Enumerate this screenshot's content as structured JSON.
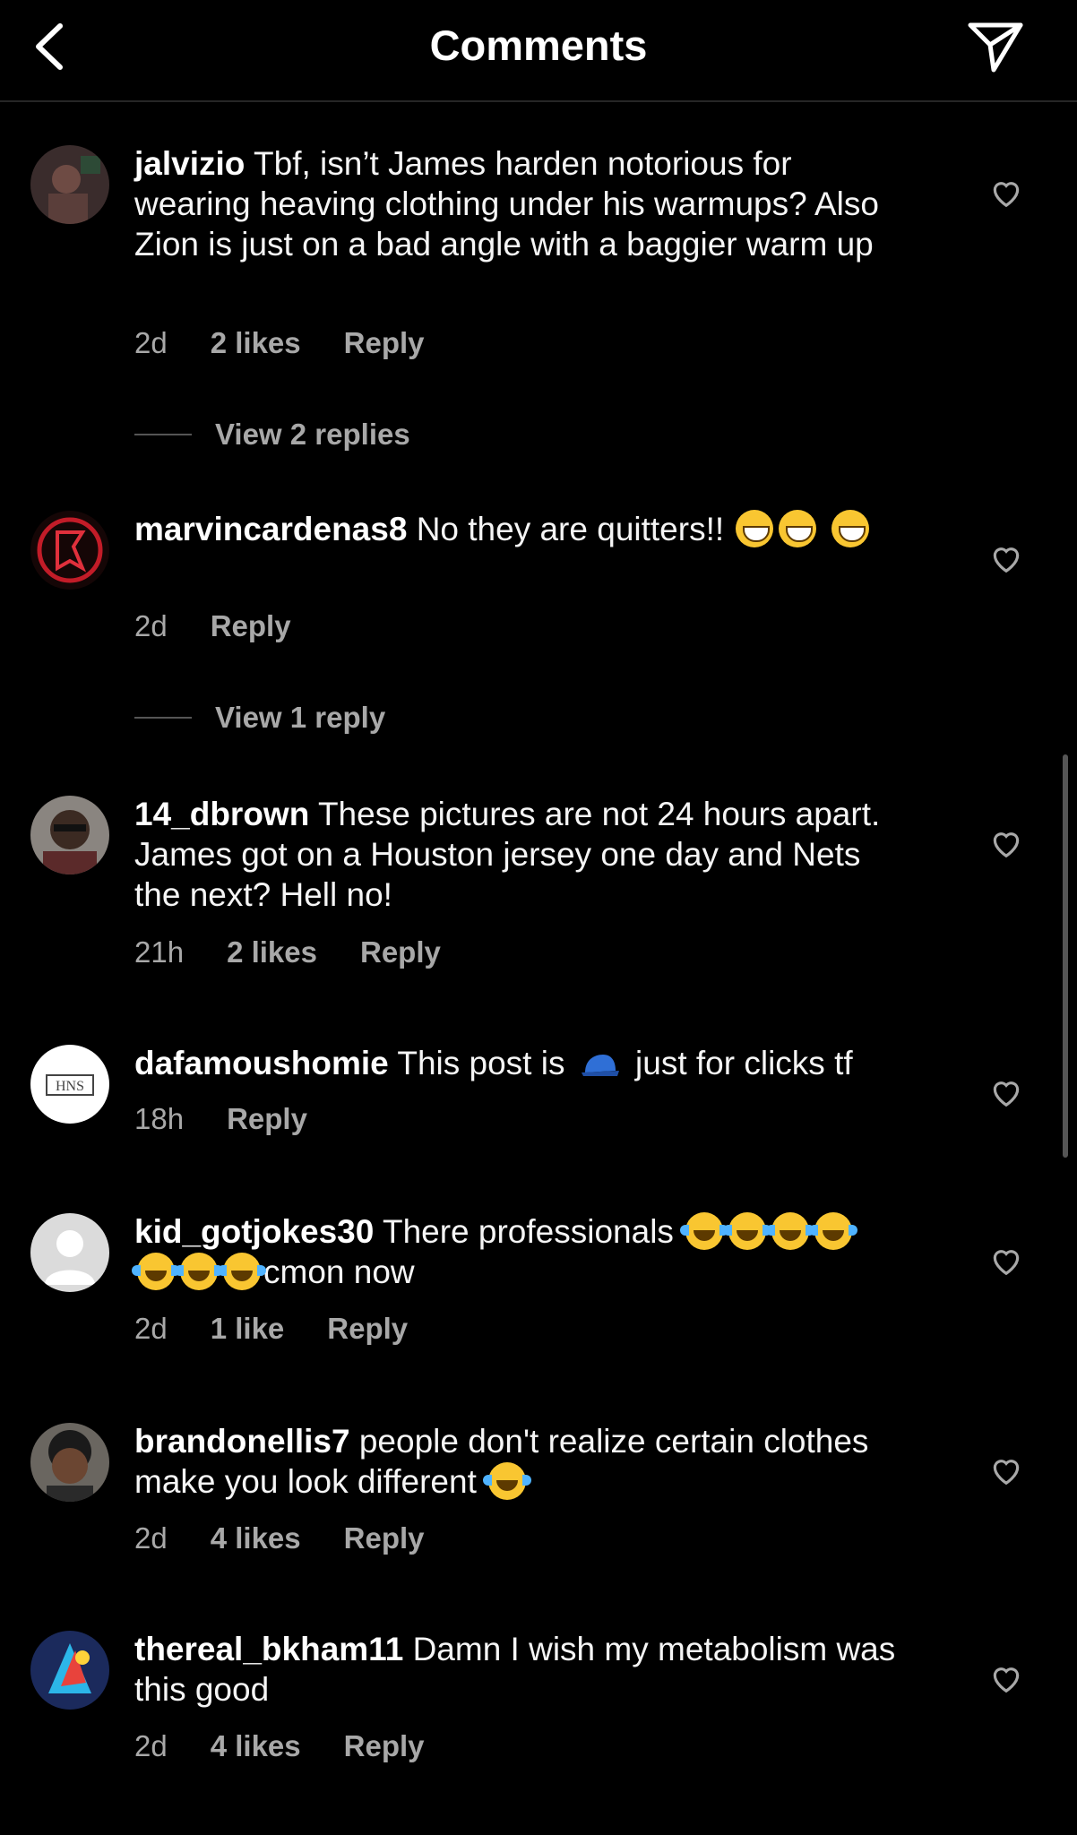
{
  "header": {
    "title": "Comments",
    "back_icon": "chevron-left-icon",
    "share_icon": "paper-plane-icon"
  },
  "comments": [
    {
      "username": "jalvizio",
      "text": "Tbf, isn’t James harden notorious for wearing heaving clothing under his warmups? Also Zion is just on a bad angle with a baggier warm up",
      "time": "2d",
      "likes": "2 likes",
      "reply": "Reply",
      "view_replies": "View 2 replies"
    },
    {
      "username": "marvincardenas8",
      "text": "No they are quitters!!",
      "time": "2d",
      "reply": "Reply",
      "view_replies": "View 1 reply"
    },
    {
      "username": "14_dbrown",
      "text": "These pictures are not 24 hours apart. James got on a Houston jersey one day and Nets the next? Hell no!",
      "time": "21h",
      "likes": "2 likes",
      "reply": "Reply"
    },
    {
      "username": "dafamoushomie",
      "text_before": "This post is",
      "text_after": "just for clicks tf",
      "time": "18h",
      "reply": "Reply"
    },
    {
      "username": "kid_gotjokes30",
      "text_before": "There professionals",
      "text_after": "cmon now",
      "time": "2d",
      "likes": "1 like",
      "reply": "Reply"
    },
    {
      "username": "brandonellis7",
      "text": "people don't realize certain clothes make you look different",
      "time": "2d",
      "likes": "4 likes",
      "reply": "Reply"
    },
    {
      "username": "thereal_bkham11",
      "text": "Damn I wish my metabolism was this good",
      "time": "2d",
      "likes": "4 likes",
      "reply": "Reply"
    }
  ],
  "colors": {
    "background": "#000000",
    "secondary_text": "#a8a8a8",
    "primary_text": "#ffffff"
  }
}
